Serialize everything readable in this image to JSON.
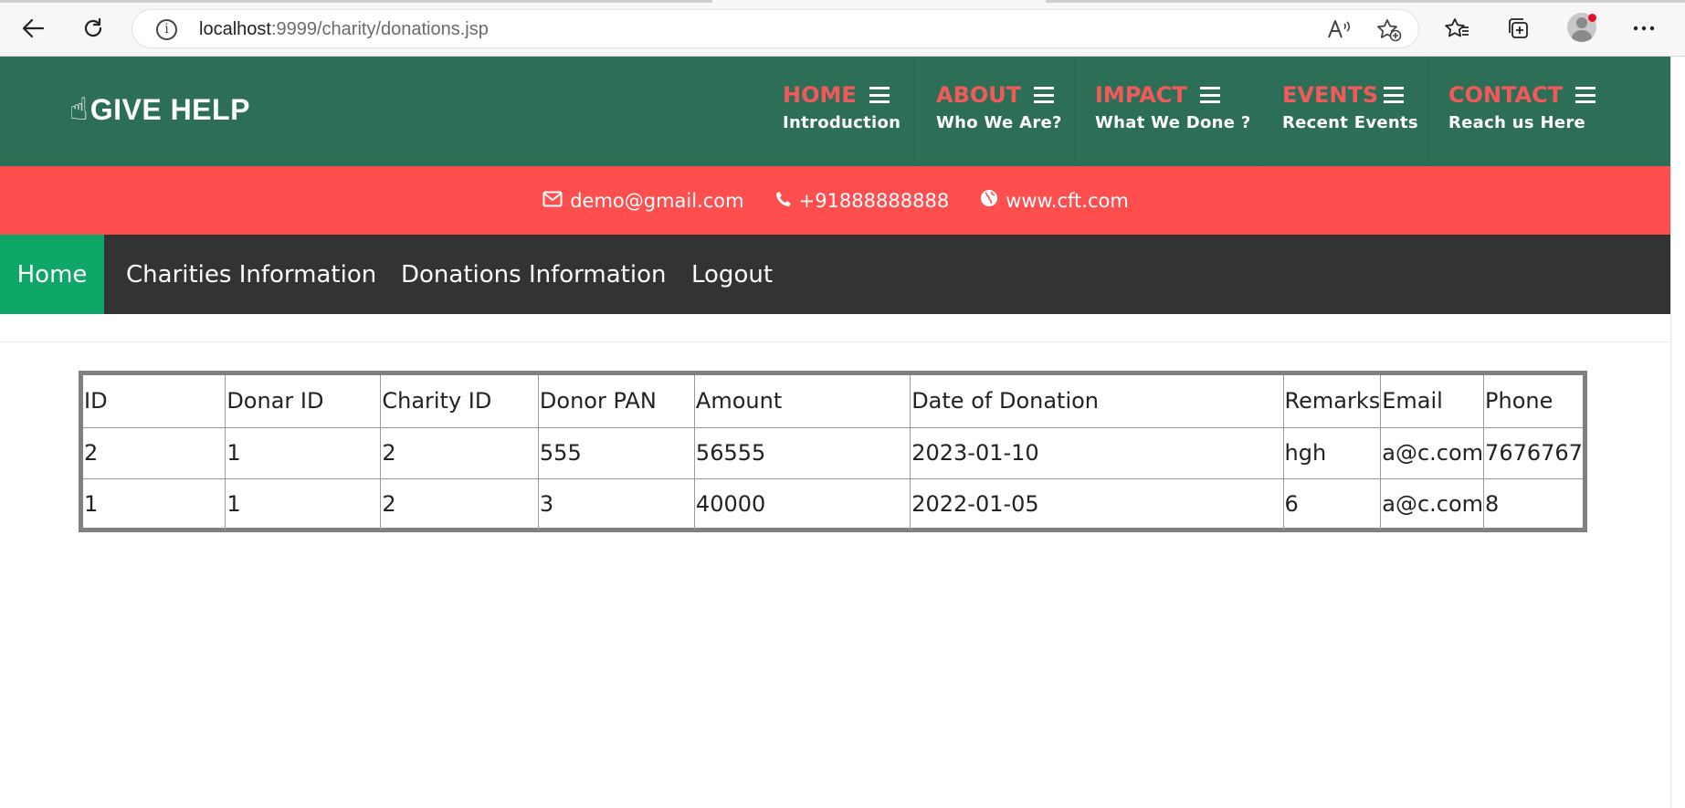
{
  "browser": {
    "url_host": "localhost",
    "url_path": ":9999/charity/donations.jsp",
    "back_icon": "arrow-left-icon",
    "refresh_icon": "refresh-icon",
    "info_icon": "info-icon",
    "read_aloud_icon": "read-aloud-icon",
    "favorite_add_icon": "star-add-icon",
    "favorites_icon": "favorites-icon",
    "collections_icon": "collections-icon",
    "profile_icon": "profile-avatar-icon",
    "more_icon": "more-icon"
  },
  "header": {
    "logo_text": "GIVE HELP",
    "logo_icon": "hand-pointing-icon",
    "nav": [
      {
        "title": "HOME",
        "subtitle": "Introduction"
      },
      {
        "title": "ABOUT",
        "subtitle": "Who We Are?"
      },
      {
        "title": "IMPACT",
        "subtitle": "What We Done ?"
      },
      {
        "title": "EVENTS",
        "subtitle": "Recent Events"
      },
      {
        "title": "CONTACT",
        "subtitle": "Reach us Here"
      }
    ],
    "colors": {
      "background": "#2d6e56",
      "nav_title": "#f25a5a"
    }
  },
  "contact": {
    "email": "demo@gmail.com",
    "phone": "+91888888888",
    "website": "www.cft.com",
    "background": "#ff4e4e"
  },
  "menu": {
    "items": [
      "Home",
      "Charities Information",
      "Donations Information",
      "Logout"
    ],
    "active": "Home",
    "active_color": "#0ea768"
  },
  "table": {
    "headers": [
      "ID",
      "Donar ID",
      "Charity ID",
      "Donor PAN",
      "Amount",
      "Date of Donation",
      "Remarks",
      "Email",
      "Phone"
    ],
    "rows": [
      [
        "2",
        "1",
        "2",
        "555",
        "56555",
        "2023-01-10",
        "hgh",
        "a@c.com",
        "7676767"
      ],
      [
        "1",
        "1",
        "2",
        "3",
        "40000",
        "2022-01-05",
        "6",
        "a@c.com",
        "8"
      ]
    ]
  }
}
